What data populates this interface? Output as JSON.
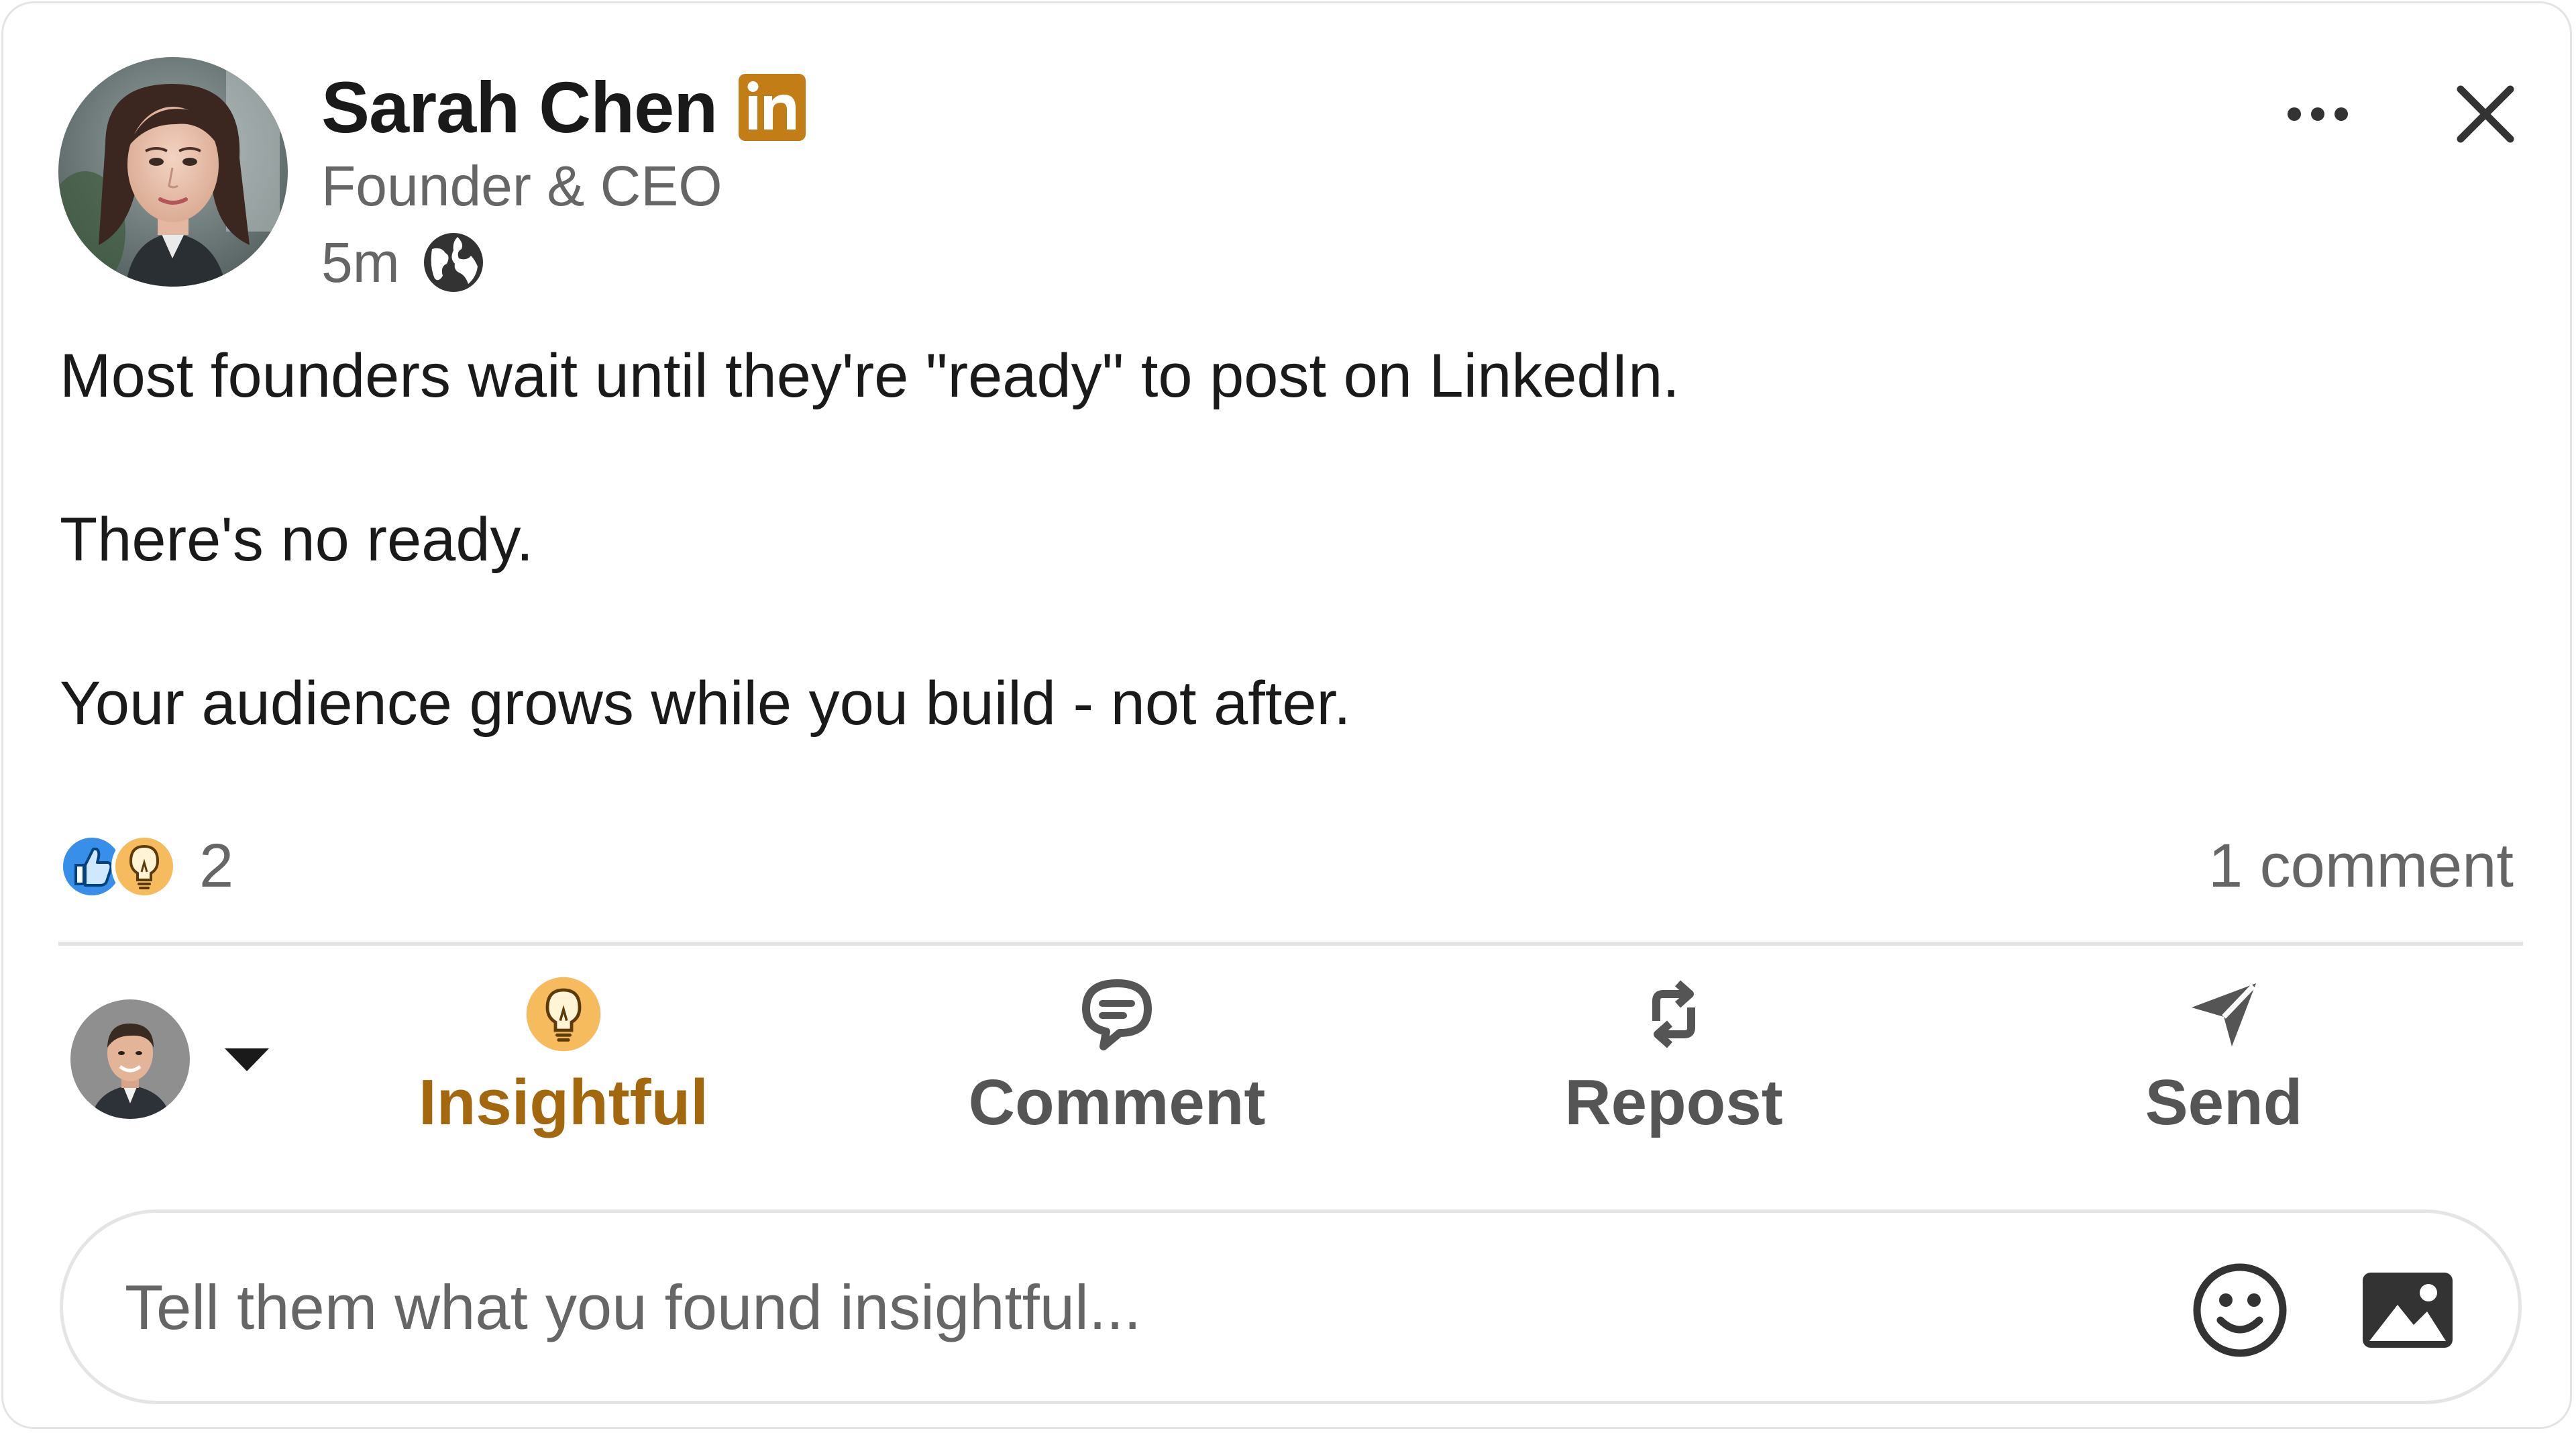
{
  "author": {
    "name": "Sarah Chen",
    "headline": "Founder & CEO",
    "time": "5m",
    "badge_text": "in",
    "badge_color": "#c37d16"
  },
  "post": {
    "lines": [
      "Most founders wait until they're \"ready\" to post on LinkedIn.",
      "There's no ready.",
      "Your audience grows while you build - not after."
    ]
  },
  "social": {
    "reaction_count": "2",
    "reaction_icons": [
      "like-icon",
      "insightful-icon"
    ],
    "comment_count": "1 comment"
  },
  "actions": {
    "insightful": "Insightful",
    "comment": "Comment",
    "repost": "Repost",
    "send": "Send",
    "active": "insightful",
    "active_color": "#a3680e"
  },
  "comment_box": {
    "placeholder": "Tell them what you found insightful..."
  },
  "colors": {
    "like_blue": "#378fe9",
    "insightful_yellow": "#f5bb5c",
    "text_secondary": "#666666"
  }
}
